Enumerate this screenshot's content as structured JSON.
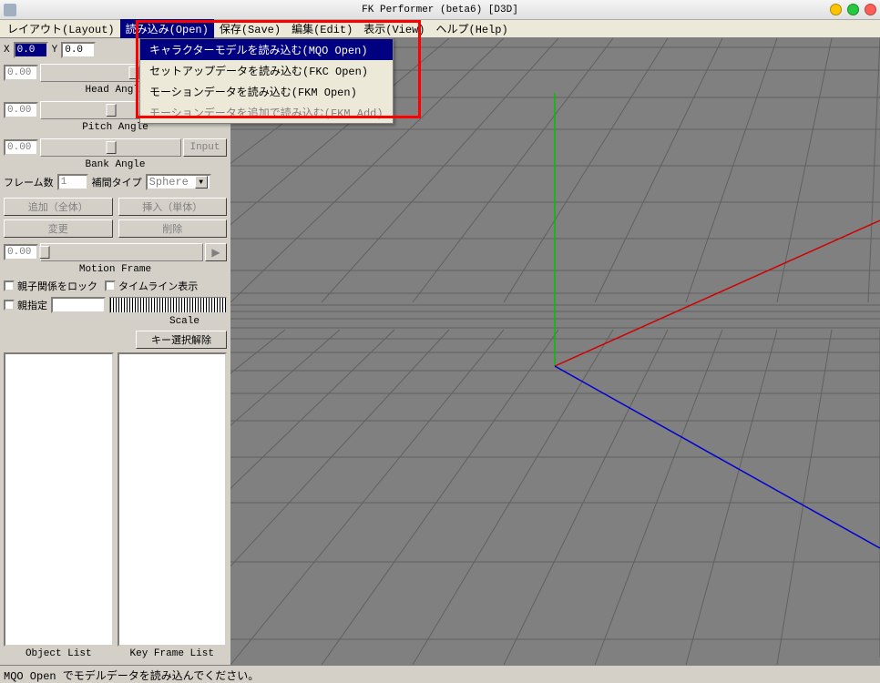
{
  "window": {
    "title": "FK Performer (beta6) [D3D]"
  },
  "menubar": {
    "layout": "レイアウト(Layout)",
    "open": "読み込み(Open)",
    "save": "保存(Save)",
    "edit": "編集(Edit)",
    "view": "表示(View)",
    "help": "ヘルプ(Help)"
  },
  "dropdown": {
    "mqo_open": "キャラクターモデルを読み込む(MQO Open)",
    "fkc_open": "セットアップデータを読み込む(FKC Open)",
    "fkm_open": "モーションデータを読み込む(FKM Open)",
    "fkm_add": "モーションデータを追加で読み込む(FKM Add)"
  },
  "sidebar": {
    "x_label": "X",
    "x_value": "0.0",
    "y_label": "Y",
    "y_value": "0.0",
    "head_angle_val": "0.00",
    "head_angle_label": "Head Angle",
    "pitch_angle_val": "0.00",
    "pitch_angle_label": "Pitch Angle",
    "bank_angle_val": "0.00",
    "bank_angle_label": "Bank Angle",
    "input_btn": "Input",
    "frame_count_label": "フレーム数",
    "frame_count_val": "1",
    "interp_label": "補間タイプ",
    "interp_val": "Sphere",
    "add_all_btn": "追加（全体）",
    "insert_single_btn": "挿入（単体）",
    "change_btn": "変更",
    "delete_btn": "削除",
    "motion_frame_val": "0.00",
    "motion_frame_label": "Motion Frame",
    "lock_parent": "親子関係をロック",
    "timeline_show": "タイムライン表示",
    "parent_spec": "親指定",
    "scale_label": "Scale",
    "key_deselect": "キー選択解除",
    "object_list": "Object List",
    "key_frame_list": "Key Frame List"
  },
  "status": {
    "text": "MQO Open でモデルデータを読み込んでください。"
  }
}
